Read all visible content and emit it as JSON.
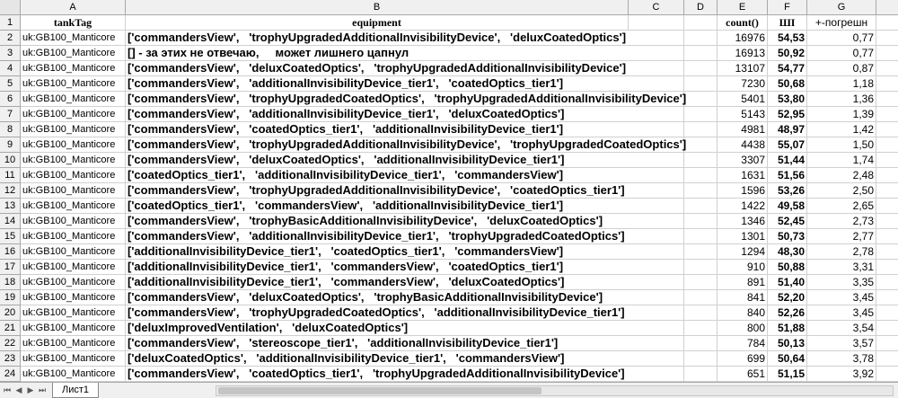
{
  "columns": [
    "A",
    "B",
    "C",
    "D",
    "E",
    "F",
    "G"
  ],
  "header_row": {
    "num": "1",
    "A": "tankTag",
    "B": "equipment",
    "E": "count()",
    "F": "ШI",
    "G": "+-погрешн"
  },
  "rows": [
    {
      "num": "2",
      "A": "uk:GB100_Manticore",
      "B": "['commandersView',   'trophyUpgradedAdditionalInvisibilityDevice',   'deluxCoatedOptics']",
      "E": "16976",
      "F": "54,53",
      "G": "0,77"
    },
    {
      "num": "3",
      "A": "uk:GB100_Manticore",
      "B": "[] - за этих не отвечаю,     может лишнего цапнул",
      "E": "16913",
      "F": "50,92",
      "G": "0,77"
    },
    {
      "num": "4",
      "A": "uk:GB100_Manticore",
      "B": "['commandersView',   'deluxCoatedOptics',   'trophyUpgradedAdditionalInvisibilityDevice']",
      "E": "13107",
      "F": "54,77",
      "G": "0,87"
    },
    {
      "num": "5",
      "A": "uk:GB100_Manticore",
      "B": "['commandersView',   'additionalInvisibilityDevice_tier1',   'coatedOptics_tier1']",
      "E": "7230",
      "F": "50,68",
      "G": "1,18"
    },
    {
      "num": "6",
      "A": "uk:GB100_Manticore",
      "B": "['commandersView',   'trophyUpgradedCoatedOptics',   'trophyUpgradedAdditionalInvisibilityDevice']",
      "E": "5401",
      "F": "53,80",
      "G": "1,36"
    },
    {
      "num": "7",
      "A": "uk:GB100_Manticore",
      "B": "['commandersView',   'additionalInvisibilityDevice_tier1',   'deluxCoatedOptics']",
      "E": "5143",
      "F": "52,95",
      "G": "1,39"
    },
    {
      "num": "8",
      "A": "uk:GB100_Manticore",
      "B": "['commandersView',   'coatedOptics_tier1',   'additionalInvisibilityDevice_tier1']",
      "E": "4981",
      "F": "48,97",
      "G": "1,42"
    },
    {
      "num": "9",
      "A": "uk:GB100_Manticore",
      "B": "['commandersView',   'trophyUpgradedAdditionalInvisibilityDevice',   'trophyUpgradedCoatedOptics']",
      "E": "4438",
      "F": "55,07",
      "G": "1,50"
    },
    {
      "num": "10",
      "A": "uk:GB100_Manticore",
      "B": "['commandersView',   'deluxCoatedOptics',   'additionalInvisibilityDevice_tier1']",
      "E": "3307",
      "F": "51,44",
      "G": "1,74"
    },
    {
      "num": "11",
      "A": "uk:GB100_Manticore",
      "B": "['coatedOptics_tier1',   'additionalInvisibilityDevice_tier1',   'commandersView']",
      "E": "1631",
      "F": "51,56",
      "G": "2,48"
    },
    {
      "num": "12",
      "A": "uk:GB100_Manticore",
      "B": "['commandersView',   'trophyUpgradedAdditionalInvisibilityDevice',   'coatedOptics_tier1']",
      "E": "1596",
      "F": "53,26",
      "G": "2,50"
    },
    {
      "num": "13",
      "A": "uk:GB100_Manticore",
      "B": "['coatedOptics_tier1',   'commandersView',   'additionalInvisibilityDevice_tier1']",
      "E": "1422",
      "F": "49,58",
      "G": "2,65"
    },
    {
      "num": "14",
      "A": "uk:GB100_Manticore",
      "B": "['commandersView',   'trophyBasicAdditionalInvisibilityDevice',   'deluxCoatedOptics']",
      "E": "1346",
      "F": "52,45",
      "G": "2,73"
    },
    {
      "num": "15",
      "A": "uk:GB100_Manticore",
      "B": "['commandersView',   'additionalInvisibilityDevice_tier1',   'trophyUpgradedCoatedOptics']",
      "E": "1301",
      "F": "50,73",
      "G": "2,77"
    },
    {
      "num": "16",
      "A": "uk:GB100_Manticore",
      "B": "['additionalInvisibilityDevice_tier1',   'coatedOptics_tier1',   'commandersView']",
      "E": "1294",
      "F": "48,30",
      "G": "2,78"
    },
    {
      "num": "17",
      "A": "uk:GB100_Manticore",
      "B": "['additionalInvisibilityDevice_tier1',   'commandersView',   'coatedOptics_tier1']",
      "E": "910",
      "F": "50,88",
      "G": "3,31"
    },
    {
      "num": "18",
      "A": "uk:GB100_Manticore",
      "B": "['additionalInvisibilityDevice_tier1',   'commandersView',   'deluxCoatedOptics']",
      "E": "891",
      "F": "51,40",
      "G": "3,35"
    },
    {
      "num": "19",
      "A": "uk:GB100_Manticore",
      "B": "['commandersView',   'deluxCoatedOptics',   'trophyBasicAdditionalInvisibilityDevice']",
      "E": "841",
      "F": "52,20",
      "G": "3,45"
    },
    {
      "num": "20",
      "A": "uk:GB100_Manticore",
      "B": "['commandersView',   'trophyUpgradedCoatedOptics',   'additionalInvisibilityDevice_tier1']",
      "E": "840",
      "F": "52,26",
      "G": "3,45"
    },
    {
      "num": "21",
      "A": "uk:GB100_Manticore",
      "B": "['deluxImprovedVentilation',   'deluxCoatedOptics']",
      "E": "800",
      "F": "51,88",
      "G": "3,54"
    },
    {
      "num": "22",
      "A": "uk:GB100_Manticore",
      "B": "['commandersView',   'stereoscope_tier1',   'additionalInvisibilityDevice_tier1']",
      "E": "784",
      "F": "50,13",
      "G": "3,57"
    },
    {
      "num": "23",
      "A": "uk:GB100_Manticore",
      "B": "['deluxCoatedOptics',   'additionalInvisibilityDevice_tier1',   'commandersView']",
      "E": "699",
      "F": "50,64",
      "G": "3,78"
    },
    {
      "num": "24",
      "A": "uk:GB100_Manticore",
      "B": "['commandersView',   'coatedOptics_tier1',   'trophyUpgradedAdditionalInvisibilityDevice']",
      "E": "651",
      "F": "51,15",
      "G": "3,92"
    }
  ],
  "sheet_tab": "Лист1",
  "nav_icons": [
    "first-sheet-icon",
    "prev-sheet-icon",
    "next-sheet-icon",
    "last-sheet-icon"
  ]
}
